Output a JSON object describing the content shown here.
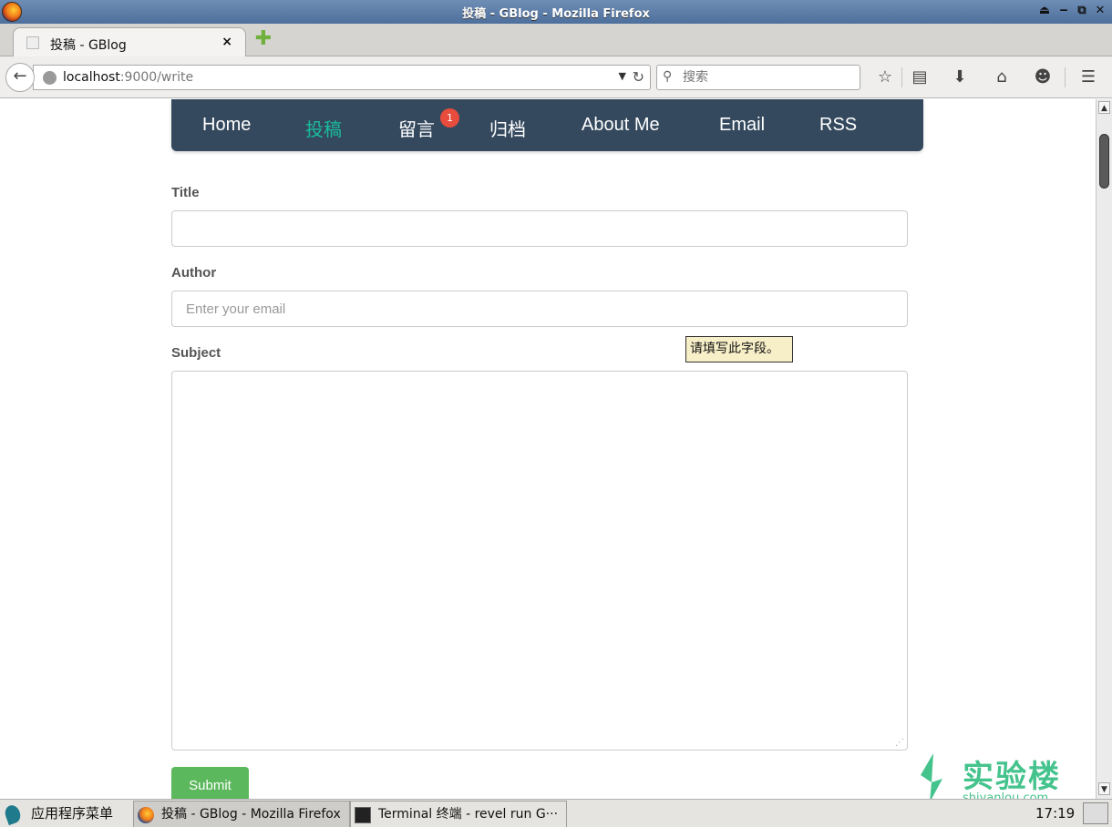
{
  "window": {
    "title": "投稿 - GBlog - Mozilla Firefox",
    "controls": [
      "⏏",
      "‒",
      "⧉",
      "✕"
    ]
  },
  "tab": {
    "title": "投稿 - GBlog",
    "close": "×",
    "new_tab": "✚"
  },
  "navbar": {
    "back": "←",
    "url_host": "localhost",
    "url_path": ":9000/write",
    "search_placeholder": "搜索",
    "toolbar_icons": {
      "bookmark": "☆",
      "reading_list": "▤",
      "download": "⬇",
      "home": "⌂",
      "chat": "☻",
      "menu": "☰"
    }
  },
  "site_nav": {
    "items": [
      {
        "label": "Home"
      },
      {
        "label": "投稿"
      },
      {
        "label": "留言"
      },
      {
        "label": "归档"
      },
      {
        "label": "About Me"
      },
      {
        "label": "Email"
      },
      {
        "label": "RSS"
      }
    ],
    "active_index": 1,
    "badge": "1"
  },
  "form": {
    "title_label": "Title",
    "title_value": "",
    "author_label": "Author",
    "author_placeholder": "Enter your email",
    "subject_label": "Subject",
    "subject_value": "",
    "submit_label": "Submit",
    "tooltip": "请填写此字段。"
  },
  "watermark": {
    "name": "实验楼",
    "url": "shiyanlou.com"
  },
  "taskbar": {
    "start_label": "应用程序菜单",
    "tasks": [
      {
        "label": "投稿 - GBlog - Mozilla Firefox"
      },
      {
        "label": "Terminal 终端 - revel run G···"
      }
    ],
    "clock": "17:19"
  },
  "colors": {
    "nav_bg": "#34495e",
    "nav_active": "#1abc9c",
    "badge": "#e74c3c",
    "submit": "#5cb85c",
    "watermark": "#45c38d"
  }
}
